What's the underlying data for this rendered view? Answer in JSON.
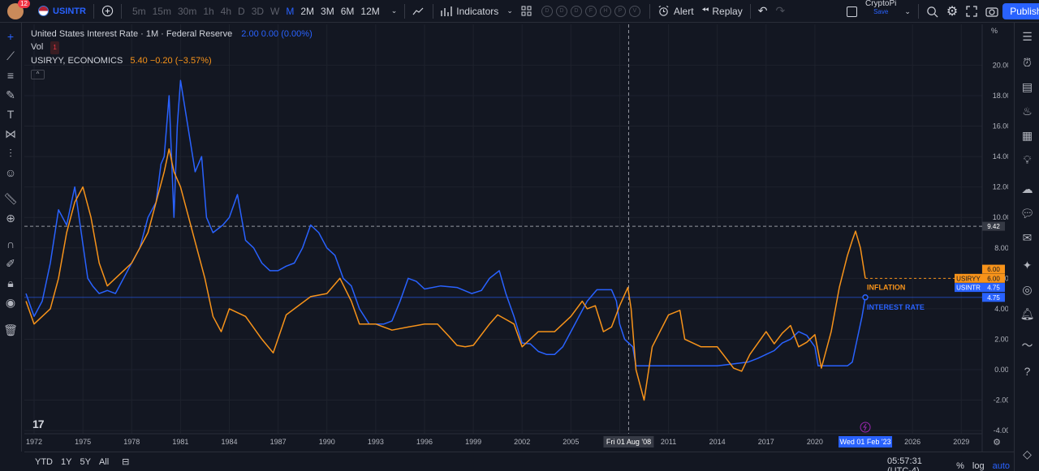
{
  "topbar": {
    "notification_count": "12",
    "symbol": "USINTR",
    "timeframes": [
      "5m",
      "15m",
      "30m",
      "1h",
      "4h",
      "D",
      "3D",
      "W",
      "M",
      "2M",
      "3M",
      "6M",
      "12M"
    ],
    "active_timeframe": "M",
    "indicators_label": "Indicators",
    "template_circles": [
      "D",
      "D",
      "D",
      "F",
      "H",
      "P",
      "V"
    ],
    "alert_label": "Alert",
    "replay_label": "Replay",
    "layout_name": "CryptoPi",
    "layout_save": "Save",
    "publish_label": "Publish"
  },
  "legend": {
    "title": "United States Interest Rate · 1M · Federal Reserve",
    "values": "2.00  0.00 (0.00%)",
    "vol_label": "Vol",
    "vol_badge": "1",
    "indicator_name": "USIRYY, ECONOMICS",
    "indicator_values": "5.40  −0.20 (−3.57%)",
    "collapse": "^"
  },
  "axis": {
    "unit": "%",
    "y_ticks": [
      "20.00",
      "18.00",
      "16.00",
      "14.00",
      "12.00",
      "10.00",
      "8.00",
      "6.00",
      "4.00",
      "2.00",
      "0.00",
      "-2.00",
      "-4.00"
    ],
    "x_ticks": [
      "1972",
      "1975",
      "1978",
      "1981",
      "1984",
      "1987",
      "1990",
      "1993",
      "1996",
      "1999",
      "2002",
      "2005",
      "2011",
      "2014",
      "2017",
      "2020",
      "2026",
      "2029"
    ],
    "crosshair_date": "Fri 01 Aug '08",
    "highlight_date": "Wed 01 Feb '23",
    "crosshair_price": "9.42"
  },
  "tags": {
    "usiryy_label": "USIRYY",
    "usiryy_value": "6.00",
    "usiryy_last": "6.00",
    "usintr_label": "USINTR",
    "usintr_value": "4.75",
    "usintr_last": "4.75"
  },
  "annotations": {
    "inflation": "INFLATION",
    "interest_rate": "INTEREST RATE"
  },
  "bottombar": {
    "ranges": [
      "YTD",
      "1Y",
      "5Y",
      "All"
    ],
    "time": "05:57:31 (UTC-4)",
    "percent": "%",
    "log": "log",
    "auto": "auto"
  },
  "colors": {
    "background": "#131722",
    "interest_line": "#2962ff",
    "inflation_line": "#f7931a",
    "grid": "#1e222d"
  },
  "chart_data": {
    "type": "line",
    "ylim": [
      -4,
      21
    ],
    "series": [
      {
        "name": "USINTR",
        "x": [
          1971.5,
          1972.0,
          1972.5,
          1973.0,
          1973.5,
          1974.0,
          1974.5,
          1974.9,
          1975.3,
          1975.6,
          1976.0,
          1976.5,
          1977.0,
          1977.5,
          1978.0,
          1978.5,
          1979.0,
          1979.5,
          1979.8,
          1980.0,
          1980.3,
          1980.6,
          1980.8,
          1981.0,
          1981.3,
          1981.6,
          1981.9,
          1982.3,
          1982.6,
          1983.0,
          1983.6,
          1984.0,
          1984.5,
          1985.0,
          1985.5,
          1986.0,
          1986.5,
          1987.0,
          1987.5,
          1988.0,
          1988.5,
          1989.0,
          1989.5,
          1990.0,
          1990.5,
          1991.0,
          1991.5,
          1992.0,
          1992.6,
          1993.5,
          1994.0,
          1994.5,
          1995.0,
          1995.5,
          1996.0,
          1997.0,
          1998.0,
          1998.9,
          1999.5,
          2000.0,
          2000.6,
          2001.0,
          2001.5,
          2002.0,
          2002.5,
          2003.0,
          2003.5,
          2004.0,
          2004.5,
          2005.0,
          2005.5,
          2006.0,
          2006.6,
          2007.5,
          2007.8,
          2008.0,
          2008.3,
          2008.8,
          2009.0,
          2010.0,
          2012.0,
          2014.0,
          2015.9,
          2016.5,
          2017.0,
          2017.5,
          2018.0,
          2018.5,
          2019.0,
          2019.5,
          2020.0,
          2020.2,
          2021.0,
          2022.0,
          2022.3,
          2022.6,
          2022.9,
          2023.1
        ],
        "values": [
          5.0,
          3.5,
          4.5,
          7.0,
          10.5,
          9.5,
          12.0,
          9.0,
          6.0,
          5.5,
          5.0,
          5.2,
          5.0,
          6.0,
          7.0,
          8.0,
          10.0,
          11.0,
          13.5,
          14.0,
          18.0,
          10.0,
          16.0,
          19.0,
          17.0,
          15.0,
          13.0,
          14.0,
          10.0,
          9.0,
          9.5,
          10.0,
          11.5,
          8.5,
          8.0,
          7.0,
          6.5,
          6.5,
          6.8,
          7.0,
          8.0,
          9.5,
          9.0,
          8.0,
          7.5,
          6.0,
          5.5,
          4.0,
          3.0,
          3.0,
          3.2,
          4.5,
          6.0,
          5.8,
          5.3,
          5.5,
          5.4,
          5.0,
          5.2,
          6.0,
          6.5,
          5.0,
          3.5,
          1.75,
          1.7,
          1.2,
          1.0,
          1.0,
          1.5,
          2.5,
          3.5,
          4.5,
          5.25,
          5.25,
          4.5,
          3.0,
          2.0,
          1.5,
          0.25,
          0.25,
          0.25,
          0.25,
          0.5,
          0.75,
          1.0,
          1.25,
          1.75,
          2.0,
          2.5,
          2.25,
          1.5,
          0.25,
          0.25,
          0.25,
          0.5,
          2.0,
          3.5,
          4.75
        ]
      },
      {
        "name": "USIRYY",
        "x": [
          1971.5,
          1972.0,
          1972.5,
          1973.0,
          1973.5,
          1974.0,
          1974.5,
          1975.0,
          1975.5,
          1976.0,
          1976.5,
          1977.0,
          1977.5,
          1978.0,
          1978.5,
          1979.0,
          1979.5,
          1980.0,
          1980.3,
          1980.6,
          1981.0,
          1981.5,
          1982.0,
          1982.5,
          1983.0,
          1983.5,
          1984.0,
          1985.0,
          1986.0,
          1986.7,
          1987.5,
          1988.0,
          1989.0,
          1990.0,
          1990.8,
          1991.5,
          1992.0,
          1993.0,
          1994.0,
          1995.0,
          1996.0,
          1996.8,
          1997.5,
          1998.0,
          1998.5,
          1999.0,
          2000.0,
          2000.5,
          2001.0,
          2001.5,
          2002.0,
          2003.0,
          2004.0,
          2005.0,
          2005.7,
          2006.0,
          2006.5,
          2007.0,
          2007.5,
          2008.0,
          2008.5,
          2008.7,
          2009.0,
          2009.5,
          2010.0,
          2011.0,
          2011.7,
          2012.0,
          2013.0,
          2014.0,
          2015.0,
          2015.5,
          2016.0,
          2017.0,
          2017.5,
          2018.0,
          2018.5,
          2019.0,
          2019.5,
          2020.0,
          2020.4,
          2021.0,
          2021.5,
          2022.0,
          2022.3,
          2022.5,
          2022.8,
          2023.1
        ],
        "values": [
          4.5,
          3.0,
          3.5,
          4.0,
          6.0,
          9.0,
          11.0,
          12.0,
          10.0,
          7.0,
          5.5,
          6.0,
          6.5,
          7.0,
          8.0,
          9.0,
          11.0,
          13.0,
          14.5,
          13.0,
          12.0,
          10.0,
          8.0,
          6.0,
          3.5,
          2.5,
          4.0,
          3.5,
          2.0,
          1.1,
          3.6,
          4.0,
          4.8,
          5.0,
          6.0,
          4.5,
          3.0,
          3.0,
          2.6,
          2.8,
          3.0,
          3.0,
          2.2,
          1.6,
          1.5,
          1.6,
          3.0,
          3.6,
          3.3,
          3.0,
          1.5,
          2.5,
          2.5,
          3.5,
          4.5,
          4.0,
          4.2,
          2.5,
          2.8,
          4.2,
          5.4,
          4.0,
          0.0,
          -2.0,
          1.5,
          3.6,
          3.9,
          2.0,
          1.5,
          1.5,
          0.1,
          -0.1,
          1.0,
          2.5,
          1.7,
          2.4,
          2.9,
          1.5,
          1.8,
          2.3,
          0.1,
          2.5,
          5.4,
          7.5,
          8.5,
          9.1,
          8.0,
          6.0
        ]
      }
    ]
  }
}
